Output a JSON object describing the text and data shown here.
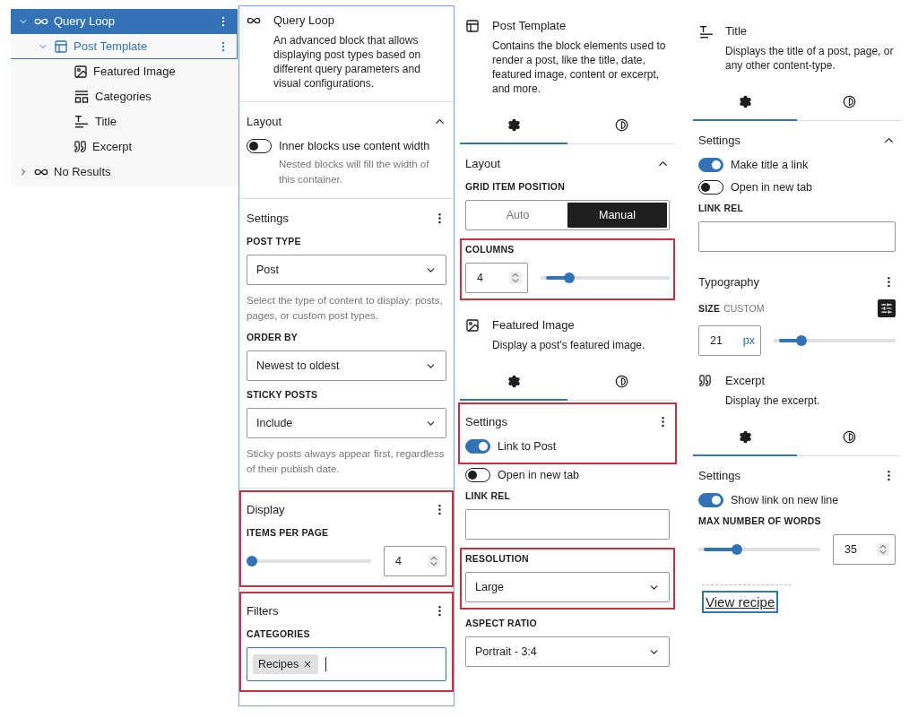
{
  "tree": {
    "items": [
      {
        "kind": "loop",
        "label": "Query Loop",
        "selected": true,
        "focused": false,
        "expanded": true,
        "children": [
          {
            "kind": "template",
            "label": "Post Template",
            "selected": false,
            "focused": true,
            "expanded": true,
            "children": [
              {
                "kind": "image",
                "label": "Featured Image",
                "selected": false,
                "focused": false
              },
              {
                "kind": "terms",
                "label": "Categories",
                "selected": false,
                "focused": false
              },
              {
                "kind": "title",
                "label": "Title",
                "selected": false,
                "focused": false
              },
              {
                "kind": "excerpt",
                "label": "Excerpt",
                "selected": false,
                "focused": false
              }
            ]
          }
        ]
      },
      {
        "kind": "loop",
        "label": "No Results",
        "selected": false,
        "focused": false,
        "expanded": false
      }
    ]
  },
  "panels": [
    {
      "outlined": true,
      "items": [
        {
          "kind": "block_info",
          "icon": {
            "kind": "loop"
          },
          "title": "Query Loop",
          "description": "An advanced block that allows displaying post types based on different query parameters and visual configurations."
        },
        {
          "kind": "divider"
        },
        {
          "kind": "section",
          "title": "Layout",
          "action": {
            "kind": "collapse"
          },
          "highlighted": false,
          "items": [
            {
              "kind": "toggle",
              "label": "Inner blocks use content width",
              "on": false,
              "help": "Nested blocks will fill the width of this container."
            }
          ]
        },
        {
          "kind": "divider"
        },
        {
          "kind": "section",
          "title": "Settings",
          "action": {
            "kind": "menu"
          },
          "highlighted": false,
          "items": [
            {
              "kind": "label",
              "text": "POST TYPE"
            },
            {
              "kind": "select",
              "value": "Post"
            },
            {
              "kind": "help",
              "text": "Select the type of content to display: posts, pages, or custom post types."
            },
            {
              "kind": "label",
              "text": "ORDER BY"
            },
            {
              "kind": "select",
              "value": "Newest to oldest"
            },
            {
              "kind": "label",
              "text": "STICKY POSTS"
            },
            {
              "kind": "select",
              "value": "Include"
            },
            {
              "kind": "help",
              "text": "Sticky posts always appear first, regardless of their publish date."
            }
          ]
        },
        {
          "kind": "divider"
        },
        {
          "kind": "section",
          "title": "Display",
          "action": {
            "kind": "menu"
          },
          "highlighted": true,
          "items": [
            {
              "kind": "label",
              "text": "ITEMS PER PAGE"
            },
            {
              "kind": "range",
              "value": "4",
              "level": 0,
              "number_first": false
            }
          ]
        },
        {
          "kind": "divider"
        },
        {
          "kind": "section",
          "title": "Filters",
          "action": {
            "kind": "menu"
          },
          "highlighted": true,
          "items": [
            {
              "kind": "label",
              "text": "CATEGORIES"
            },
            {
              "kind": "tokens",
              "tokens": [
                "Recipes"
              ],
              "focused": true
            }
          ]
        }
      ]
    },
    {
      "outlined": false,
      "items": [
        {
          "kind": "block_info",
          "icon": {
            "kind": "template"
          },
          "title": "Post Template",
          "description": "Contains the block elements used to render a post, like the title, date, featured image, content or excerpt, and more."
        },
        {
          "kind": "tabs",
          "tabs": [
            {
              "kind": "settings",
              "selected": true
            },
            {
              "kind": "styles",
              "selected": false
            }
          ]
        },
        {
          "kind": "section",
          "title": "Layout",
          "action": {
            "kind": "collapse"
          },
          "highlighted": false,
          "items": [
            {
              "kind": "label",
              "text": "GRID ITEM POSITION"
            },
            {
              "kind": "segmented",
              "options": [
                {
                  "label": "Auto",
                  "selected": false
                },
                {
                  "label": "Manual",
                  "selected": true
                }
              ]
            },
            {
              "kind": "group",
              "highlighted": true,
              "items": [
                {
                  "kind": "label",
                  "text": "COLUMNS"
                },
                {
                  "kind": "range",
                  "value": "4",
                  "level": 0.2,
                  "number_first": true
                }
              ]
            }
          ]
        },
        {
          "kind": "block_info",
          "icon": {
            "kind": "image"
          },
          "title": "Featured Image",
          "description": "Display a post's featured image."
        },
        {
          "kind": "tabs",
          "tabs": [
            {
              "kind": "settings",
              "selected": true
            },
            {
              "kind": "styles",
              "selected": false
            }
          ]
        },
        {
          "kind": "section",
          "title": "Settings",
          "action": {
            "kind": "menu"
          },
          "highlighted": true,
          "items": [
            {
              "kind": "toggle",
              "label": "Link to Post",
              "on": true
            }
          ]
        },
        {
          "kind": "toggle",
          "label": "Open in new tab",
          "on": false
        },
        {
          "kind": "label",
          "text": "LINK REL"
        },
        {
          "kind": "input",
          "value": ""
        },
        {
          "kind": "group",
          "highlighted": true,
          "items": [
            {
              "kind": "label",
              "text": "RESOLUTION"
            },
            {
              "kind": "select",
              "value": "Large"
            }
          ]
        },
        {
          "kind": "label",
          "text": "ASPECT RATIO"
        },
        {
          "kind": "select",
          "value": "Portrait - 3:4"
        }
      ]
    },
    {
      "outlined": false,
      "items": [
        {
          "kind": "block_info",
          "icon": {
            "kind": "title"
          },
          "title": "Title",
          "description": "Displays the title of a post, page, or any other content-type."
        },
        {
          "kind": "tabs",
          "tabs": [
            {
              "kind": "settings",
              "selected": true
            },
            {
              "kind": "styles",
              "selected": false
            }
          ]
        },
        {
          "kind": "section",
          "title": "Settings",
          "action": {
            "kind": "collapse"
          },
          "highlighted": false,
          "items": [
            {
              "kind": "toggle",
              "label": "Make title a link",
              "on": true
            },
            {
              "kind": "toggle",
              "label": "Open in new tab",
              "on": false
            },
            {
              "kind": "label",
              "text": "LINK REL"
            },
            {
              "kind": "input",
              "value": ""
            }
          ]
        },
        {
          "kind": "section",
          "title": "Typography",
          "action": {
            "kind": "menu"
          },
          "highlighted": false,
          "items": [
            {
              "kind": "size_label",
              "text": "SIZE",
              "hint": "CUSTOM"
            },
            {
              "kind": "range",
              "value": "21",
              "unit": "px",
              "level": 0.2,
              "number_first": true
            }
          ]
        },
        {
          "kind": "block_info",
          "icon": {
            "kind": "excerpt"
          },
          "title": "Excerpt",
          "description": "Display the excerpt."
        },
        {
          "kind": "tabs",
          "tabs": [
            {
              "kind": "settings",
              "selected": true
            },
            {
              "kind": "styles",
              "selected": false
            }
          ]
        },
        {
          "kind": "section",
          "title": "Settings",
          "action": {
            "kind": "menu"
          },
          "highlighted": false,
          "items": [
            {
              "kind": "toggle",
              "label": "Show link on new line",
              "on": true
            },
            {
              "kind": "label",
              "text": "MAX NUMBER OF WORDS"
            },
            {
              "kind": "range",
              "value": "35",
              "level": 0.3,
              "number_first": false
            }
          ]
        },
        {
          "kind": "link_preview",
          "text": "View recipe"
        }
      ]
    }
  ]
}
